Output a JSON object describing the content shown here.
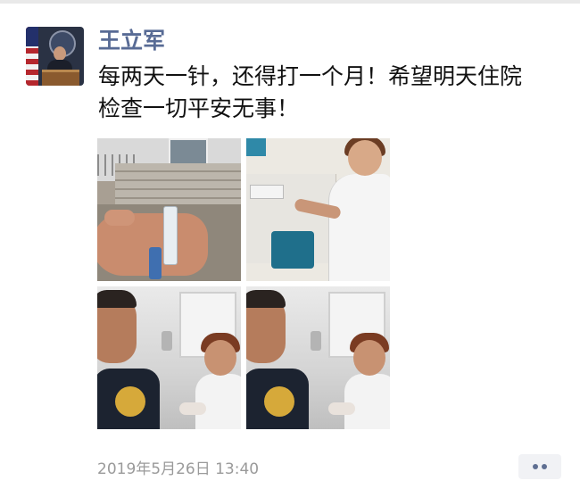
{
  "post": {
    "author_name": "王立军",
    "content_line1": "每两天一针，还得打一个月！希望明天住院",
    "content_line2": "检查一切平安无事！",
    "timestamp": "2019年5月26日 13:40",
    "more_icon": "more-dots-icon"
  },
  "photos": [
    {
      "subject": "vial-in-hand"
    },
    {
      "subject": "nurse-at-table"
    },
    {
      "subject": "selfie-with-nurse"
    },
    {
      "subject": "selfie-with-nurse"
    }
  ],
  "colors": {
    "author_name": "#586b95",
    "text": "#111111",
    "timestamp": "#9a9a9a",
    "more_button_bg": "#f1f2f5"
  }
}
